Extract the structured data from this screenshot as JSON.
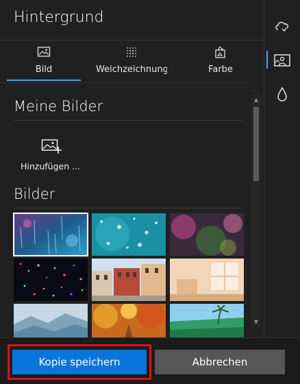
{
  "panel": {
    "title": "Hintergrund",
    "tabs": [
      {
        "label": "Bild",
        "icon": "image-icon",
        "active": true
      },
      {
        "label": "Weichzeichnung",
        "icon": "blur-dots-icon",
        "active": false
      },
      {
        "label": "Farbe",
        "icon": "paint-bucket-icon",
        "active": false
      }
    ]
  },
  "my_images": {
    "heading": "Meine Bilder",
    "add_label": "Hinzufügen ..."
  },
  "images": {
    "heading": "Bilder",
    "thumbnails": [
      {
        "name": "rain-drops-window",
        "selected": true
      },
      {
        "name": "teal-bokeh-drops",
        "selected": false
      },
      {
        "name": "pink-green-bokeh",
        "selected": false
      },
      {
        "name": "starfield-lights",
        "selected": false
      },
      {
        "name": "venice-street",
        "selected": false
      },
      {
        "name": "bright-room",
        "selected": false
      },
      {
        "name": "misty-mountains",
        "selected": false
      },
      {
        "name": "autumn-path",
        "selected": false
      },
      {
        "name": "tropical-beach",
        "selected": false
      }
    ]
  },
  "rail": {
    "items": [
      {
        "icon": "cloud-effects-icon",
        "active": false
      },
      {
        "icon": "background-image-icon",
        "active": true
      },
      {
        "icon": "water-drop-icon",
        "active": false
      }
    ]
  },
  "footer": {
    "save_label": "Kopie speichern",
    "cancel_label": "Abbrechen"
  },
  "colors": {
    "accent": "#0a74da",
    "highlight_frame": "#e0101a",
    "background": "#202020"
  }
}
